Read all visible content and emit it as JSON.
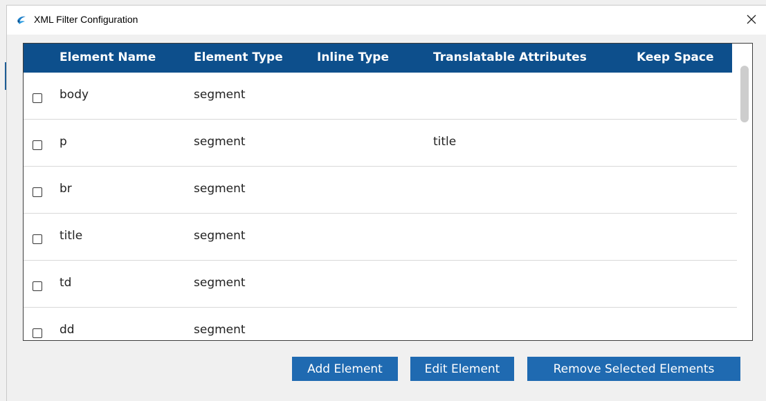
{
  "window": {
    "title": "XML Filter Configuration"
  },
  "icons": {
    "app": "app-logo-icon",
    "close": "close-icon",
    "checkbox": "checkbox-unchecked"
  },
  "table": {
    "columns": [
      "Element Name",
      "Element Type",
      "Inline Type",
      "Translatable Attributes",
      "Keep Space"
    ],
    "rows": [
      {
        "checked": false,
        "name": "body",
        "type": "segment",
        "inline": "",
        "attrs": "",
        "keep": ""
      },
      {
        "checked": false,
        "name": "p",
        "type": "segment",
        "inline": "",
        "attrs": "title",
        "keep": ""
      },
      {
        "checked": false,
        "name": "br",
        "type": "segment",
        "inline": "",
        "attrs": "",
        "keep": ""
      },
      {
        "checked": false,
        "name": "title",
        "type": "segment",
        "inline": "",
        "attrs": "",
        "keep": ""
      },
      {
        "checked": false,
        "name": "td",
        "type": "segment",
        "inline": "",
        "attrs": "",
        "keep": ""
      },
      {
        "checked": false,
        "name": "dd",
        "type": "segment",
        "inline": "",
        "attrs": "",
        "keep": ""
      }
    ]
  },
  "buttons": {
    "add": "Add Element",
    "edit": "Edit Element",
    "remove": "Remove Selected Elements"
  },
  "colors": {
    "header_bg": "#0d4f8c",
    "button_bg": "#1f6ab1",
    "window_bg": "#f0f0f0"
  }
}
